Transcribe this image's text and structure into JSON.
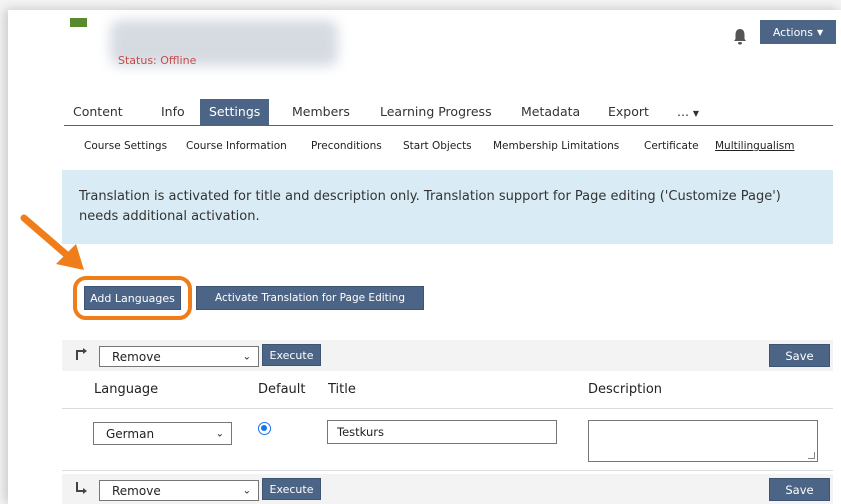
{
  "header": {
    "status": "Status: Offline",
    "actions_label": "Actions"
  },
  "tabs": [
    {
      "label": "Content"
    },
    {
      "label": "Info"
    },
    {
      "label": "Settings",
      "active": true
    },
    {
      "label": "Members"
    },
    {
      "label": "Learning Progress"
    },
    {
      "label": "Metadata"
    },
    {
      "label": "Export"
    },
    {
      "label": "..."
    }
  ],
  "subtabs": [
    {
      "label": "Course Settings"
    },
    {
      "label": "Course Information"
    },
    {
      "label": "Preconditions"
    },
    {
      "label": "Start Objects"
    },
    {
      "label": "Membership Limitations"
    },
    {
      "label": "Certificate"
    },
    {
      "label": "Multilingualism",
      "active": true
    }
  ],
  "info_message": "Translation is activated for title and description only. Translation support for Page editing ('Customize Page') needs additional activation.",
  "buttons": {
    "add_languages": "Add Languages",
    "activate_translation": "Activate Translation for Page Editing"
  },
  "table_actions": {
    "selected_action": "Remove",
    "execute_label": "Execute",
    "save_label": "Save"
  },
  "table": {
    "headers": {
      "language": "Language",
      "default": "Default",
      "title": "Title",
      "description": "Description"
    },
    "rows": [
      {
        "language": "German",
        "default": true,
        "title": "Testkurs",
        "description": ""
      }
    ]
  },
  "colors": {
    "primary": "#4c6586",
    "info_bg": "#d9ecf5",
    "highlight": "#ef7e1a",
    "status_offline": "#c84a4a"
  },
  "icons": [
    "notification-bell-icon",
    "dropdown-caret-icon",
    "arrow-up-right-icon",
    "arrow-down-right-icon",
    "orange-pointer-arrow"
  ]
}
